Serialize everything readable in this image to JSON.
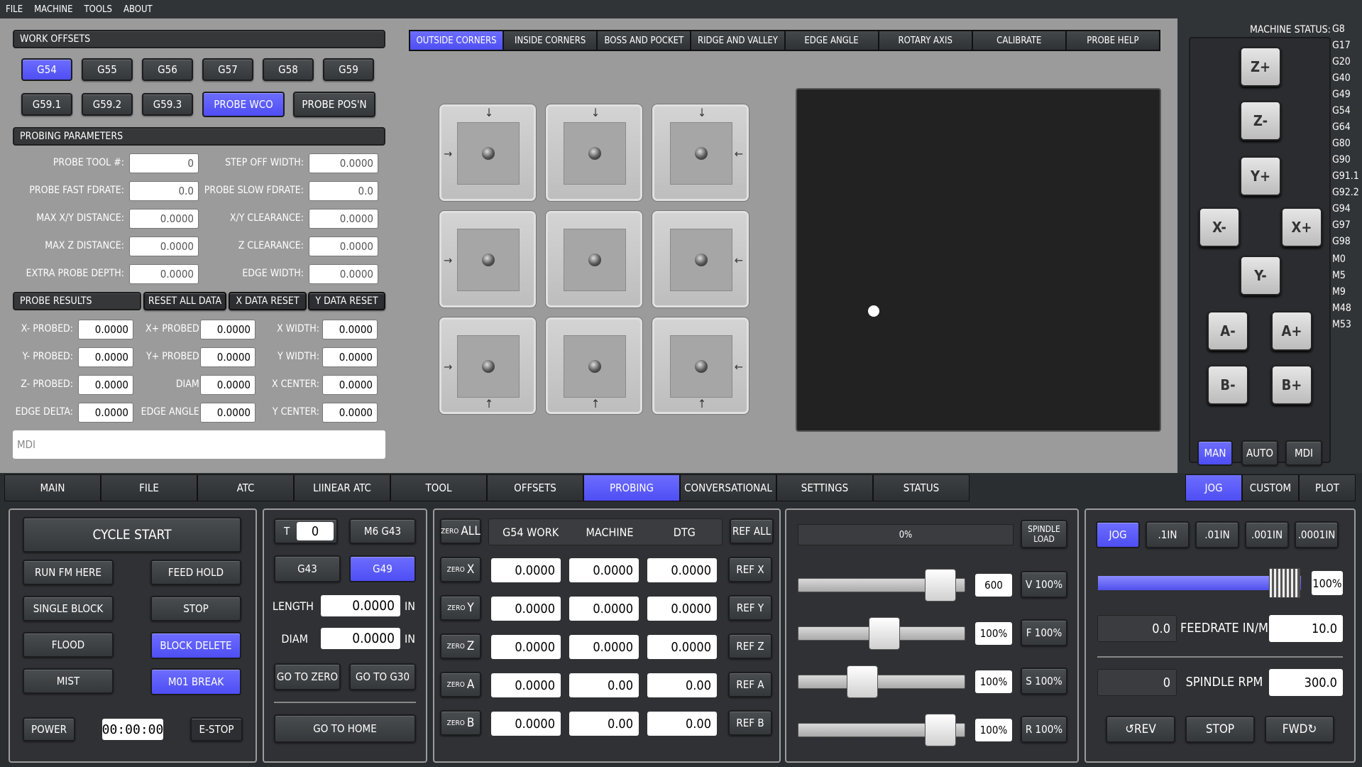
{
  "menu": [
    "FILE",
    "MACHINE",
    "TOOLS",
    "ABOUT"
  ],
  "work_offsets": {
    "title": "WORK OFFSETS",
    "row1": [
      "G54",
      "G55",
      "G56",
      "G57",
      "G58",
      "G59"
    ],
    "row2": [
      "G59.1",
      "G59.2",
      "G59.3"
    ],
    "probe_wco": "PROBE WCO",
    "probe_posn": "PROBE POS'N"
  },
  "probing_params": {
    "title": "PROBING PARAMETERS",
    "left": [
      {
        "label": "PROBE TOOL #:",
        "value": "0"
      },
      {
        "label": "PROBE FAST FDRATE:",
        "value": "0.0"
      },
      {
        "label": "MAX X/Y DISTANCE:",
        "value": "0.0000"
      },
      {
        "label": "MAX Z DISTANCE:",
        "value": "0.0000"
      },
      {
        "label": "EXTRA PROBE DEPTH:",
        "value": "0.0000"
      }
    ],
    "right": [
      {
        "label": "STEP OFF WIDTH:",
        "value": "0.0000"
      },
      {
        "label": "PROBE SLOW FDRATE:",
        "value": "0.0"
      },
      {
        "label": "X/Y CLEARANCE:",
        "value": "0.0000"
      },
      {
        "label": "Z CLEARANCE:",
        "value": "0.0000"
      },
      {
        "label": "EDGE WIDTH:",
        "value": "0.0000"
      }
    ]
  },
  "probe_results": {
    "title": "PROBE RESULTS",
    "reset_all": "RESET ALL DATA",
    "x_reset": "X DATA RESET",
    "y_reset": "Y DATA RESET",
    "rows": [
      [
        {
          "label": "X- PROBED:",
          "value": "0.0000"
        },
        {
          "label": "X+ PROBED:",
          "value": "0.0000"
        },
        {
          "label": "X WIDTH:",
          "value": "0.0000"
        }
      ],
      [
        {
          "label": "Y- PROBED:",
          "value": "0.0000"
        },
        {
          "label": "Y+ PROBED:",
          "value": "0.0000"
        },
        {
          "label": "Y WIDTH:",
          "value": "0.0000"
        }
      ],
      [
        {
          "label": "Z- PROBED:",
          "value": "0.0000"
        },
        {
          "label": "DIAM:",
          "value": "0.0000"
        },
        {
          "label": "X CENTER:",
          "value": "0.0000"
        }
      ],
      [
        {
          "label": "EDGE DELTA:",
          "value": "0.0000"
        },
        {
          "label": "EDGE ANGLE:",
          "value": "0.0000"
        },
        {
          "label": "Y CENTER:",
          "value": "0.0000"
        }
      ]
    ]
  },
  "mdi_placeholder": "MDI",
  "probe_tabs": [
    "OUTSIDE CORNERS",
    "INSIDE CORNERS",
    "BOSS AND POCKET",
    "RIDGE AND VALLEY",
    "EDGE ANGLE",
    "ROTARY AXIS",
    "CALIBRATE",
    "PROBE HELP"
  ],
  "machine_status": {
    "title": "MACHINE STATUS:",
    "codes": [
      "G8",
      "G17",
      "G20",
      "G40",
      "G49",
      "G54",
      "G64",
      "G80",
      "G90",
      "G91.1",
      "G92.2",
      "G94",
      "G97",
      "G98",
      "M0",
      "M5",
      "M9",
      "M48",
      "M53"
    ]
  },
  "jog_pad": {
    "z_plus": "Z+",
    "z_minus": "Z-",
    "y_plus": "Y+",
    "y_minus": "Y-",
    "x_minus": "X-",
    "x_plus": "X+",
    "a_minus": "A-",
    "a_plus": "A+",
    "b_minus": "B-",
    "b_plus": "B+",
    "modes": [
      "MAN",
      "AUTO",
      "MDI"
    ]
  },
  "main_tabs": [
    "MAIN",
    "FILE",
    "ATC",
    "LIINEAR ATC",
    "TOOL",
    "OFFSETS",
    "PROBING",
    "CONVERSATIONAL",
    "SETTINGS",
    "STATUS"
  ],
  "right_tabs": [
    "JOG",
    "CUSTOM",
    "PLOT"
  ],
  "cycle": {
    "cycle_start": "CYCLE START",
    "run_from_here": "RUN FM HERE",
    "feed_hold": "FEED HOLD",
    "single_block": "SINGLE BLOCK",
    "stop": "STOP",
    "flood": "FLOOD",
    "block_delete": "BLOCK DELETE",
    "mist": "MIST",
    "m01_break": "M01 BREAK",
    "power": "POWER",
    "timer": "00:00:00",
    "estop": "E-STOP"
  },
  "tool": {
    "t_label": "T",
    "t_value": "0",
    "m6g43": "M6 G43",
    "g43": "G43",
    "g49": "G49",
    "length_label": "LENGTH",
    "length_value": "0.0000",
    "length_unit": "IN",
    "diam_label": "DIAM",
    "diam_value": "0.0000",
    "diam_unit": "IN",
    "goto_zero": "GO TO ZERO",
    "goto_g30": "GO TO G30",
    "goto_home": "GO TO HOME"
  },
  "dro": {
    "zero_all": "ZERO",
    "zero_all_b": "ALL",
    "headers": [
      "G54 WORK",
      "MACHINE",
      "DTG"
    ],
    "ref_all": "REF ALL",
    "rows": [
      {
        "axis": "X",
        "work": "0.0000",
        "machine": "0.0000",
        "dtg": "0.0000",
        "ref": "REF X"
      },
      {
        "axis": "Y",
        "work": "0.0000",
        "machine": "0.0000",
        "dtg": "0.0000",
        "ref": "REF Y"
      },
      {
        "axis": "Z",
        "work": "0.0000",
        "machine": "0.0000",
        "dtg": "0.0000",
        "ref": "REF Z"
      },
      {
        "axis": "A",
        "work": "0.0000",
        "machine": "0.00",
        "dtg": "0.00",
        "ref": "REF A"
      },
      {
        "axis": "B",
        "work": "0.0000",
        "machine": "0.00",
        "dtg": "0.00",
        "ref": "REF B"
      }
    ],
    "zero_label": "ZERO"
  },
  "overrides": {
    "spindle_load": "0%",
    "spindle_load_btn1": "SPINDLE",
    "spindle_load_btn2": "LOAD",
    "rows": [
      {
        "value": "600",
        "btn": "V 100%",
        "fraction": 0.93
      },
      {
        "value": "100%",
        "btn": "F 100%",
        "fraction": 0.52
      },
      {
        "value": "100%",
        "btn": "S 100%",
        "fraction": 0.36
      },
      {
        "value": "100%",
        "btn": "R 100%",
        "fraction": 0.93
      }
    ]
  },
  "jog_panel": {
    "increments": [
      "JOG",
      ".1IN",
      ".01IN",
      ".001IN",
      ".0001IN"
    ],
    "jog_rate": "100%",
    "feed_actual": "0.0",
    "feedrate_label": "FEEDRATE IN/M",
    "feedrate_value": "10.0",
    "spindle_actual": "0",
    "spindle_label": "SPINDLE RPM",
    "spindle_value": "300.0",
    "rev": "REV",
    "stop": "STOP",
    "fwd": "FWD"
  },
  "colors": {
    "accent": "#5a5af9",
    "bg": "#2b2e31",
    "pane": "#9b9b9b"
  }
}
